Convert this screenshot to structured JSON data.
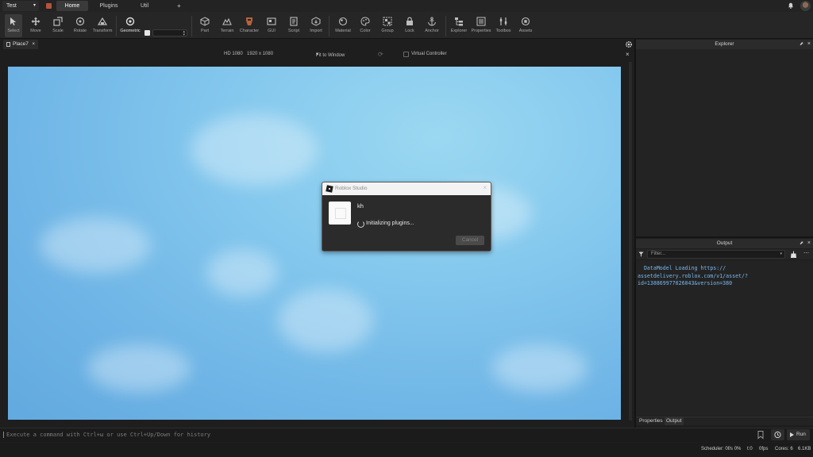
{
  "menubar": {
    "place_selector": "Test",
    "tabs": [
      {
        "label": "Home",
        "active": true
      },
      {
        "label": "Plugins",
        "active": false
      },
      {
        "label": "Util",
        "active": false
      }
    ],
    "add_tab": "+"
  },
  "ribbon": {
    "tools": [
      {
        "label": "Select",
        "icon": "cursor-icon"
      },
      {
        "label": "Move",
        "icon": "move-icon"
      },
      {
        "label": "Scale",
        "icon": "scale-icon"
      },
      {
        "label": "Rotate",
        "icon": "rotate-icon"
      },
      {
        "label": "Transform",
        "icon": "transform-icon"
      },
      {
        "label": "Geometric",
        "icon": "geometric-icon"
      },
      {
        "label": "Part",
        "icon": "part-cube-icon"
      },
      {
        "label": "Terrain",
        "icon": "terrain-icon"
      },
      {
        "label": "Character",
        "icon": "character-icon"
      },
      {
        "label": "GUI",
        "icon": "gui-icon"
      },
      {
        "label": "Script",
        "icon": "script-icon"
      },
      {
        "label": "Import",
        "icon": "import-icon"
      },
      {
        "label": "Material",
        "icon": "material-icon"
      },
      {
        "label": "Color",
        "icon": "color-palette-icon"
      },
      {
        "label": "Group",
        "icon": "group-icon"
      },
      {
        "label": "Lock",
        "icon": "lock-icon"
      },
      {
        "label": "Anchor",
        "icon": "anchor-icon"
      },
      {
        "label": "Explorer",
        "icon": "explorer-icon"
      },
      {
        "label": "Properties",
        "icon": "properties-icon"
      },
      {
        "label": "Toolbox",
        "icon": "toolbox-icon"
      },
      {
        "label": "Assets",
        "icon": "assets-icon"
      }
    ]
  },
  "document": {
    "tab_label": "Place7",
    "close": "×"
  },
  "viewport_header": {
    "device": "HD 1080",
    "resolution": "1920 x 1080",
    "fit": "Fit to Window",
    "virtual_controller": "Virtual Controller",
    "close": "×"
  },
  "dialog": {
    "title": "Roblox Studio",
    "close": "×",
    "plugin_name": "kh",
    "status": "Initializing plugins...",
    "cancel_label": "Cancel"
  },
  "explorer": {
    "title": "Explorer"
  },
  "output": {
    "title": "Output",
    "filter_placeholder": "Filter...",
    "more": "⋯",
    "lines": [
      "  DataModel Loading https://\nassetdelivery.roblox.com/v1/asset/?\nid=138869977026043&version=380"
    ]
  },
  "bottom_tabs": [
    {
      "label": "Properties",
      "active": false
    },
    {
      "label": "Output",
      "active": true
    }
  ],
  "command_bar": {
    "placeholder": "Execute a command with Ctrl+ω or use Ctrl+Up/Down for history",
    "run_label": "Run"
  },
  "status_bar": {
    "scheduler": "Scheduler: 0f/s 0%",
    "t": "t:0",
    "fps": "0fps",
    "cores": "Cores: 6",
    "memory": "6.1KB"
  },
  "colors": {
    "accent_blue": "#7ab8ef",
    "sky_light": "#9bd8f1",
    "sky_dark": "#62a9df",
    "panel_bg": "#232323"
  }
}
